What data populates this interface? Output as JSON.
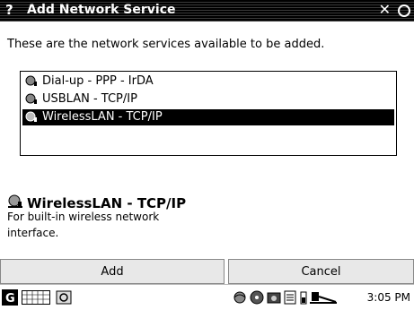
{
  "window": {
    "title_glyph": "?",
    "title": "Add Network Service",
    "close_glyph": "✕"
  },
  "intro_text": "These are the network services available to be added.",
  "services": [
    {
      "label": "Dial-up - PPP - IrDA",
      "icon": "network-plug-icon",
      "selected": false
    },
    {
      "label": "USBLAN - TCP/IP",
      "icon": "network-plug-icon",
      "selected": false
    },
    {
      "label": "WirelessLAN - TCP/IP",
      "icon": "network-plug-icon",
      "selected": true
    }
  ],
  "detail": {
    "title": "WirelessLAN - TCP/IP",
    "description": "For built-in wireless network interface."
  },
  "buttons": {
    "add": "Add",
    "cancel": "Cancel"
  },
  "taskbar": {
    "time": "3:05 PM",
    "icons": [
      "start-menu-icon",
      "keyboard-icon",
      "settings-icon",
      "network-icon",
      "cd-icon",
      "camera-icon",
      "document-icon",
      "battery-icon",
      "plug-icon"
    ]
  }
}
